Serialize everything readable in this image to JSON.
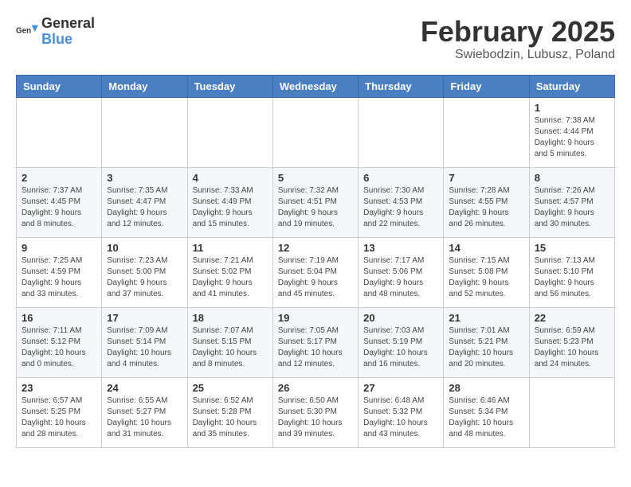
{
  "header": {
    "logo_line1": "General",
    "logo_line2": "Blue",
    "month_year": "February 2025",
    "location": "Swiebodzin, Lubusz, Poland"
  },
  "weekdays": [
    "Sunday",
    "Monday",
    "Tuesday",
    "Wednesday",
    "Thursday",
    "Friday",
    "Saturday"
  ],
  "weeks": [
    [
      {
        "day": "",
        "info": ""
      },
      {
        "day": "",
        "info": ""
      },
      {
        "day": "",
        "info": ""
      },
      {
        "day": "",
        "info": ""
      },
      {
        "day": "",
        "info": ""
      },
      {
        "day": "",
        "info": ""
      },
      {
        "day": "1",
        "info": "Sunrise: 7:38 AM\nSunset: 4:44 PM\nDaylight: 9 hours and 5 minutes."
      }
    ],
    [
      {
        "day": "2",
        "info": "Sunrise: 7:37 AM\nSunset: 4:45 PM\nDaylight: 9 hours and 8 minutes."
      },
      {
        "day": "3",
        "info": "Sunrise: 7:35 AM\nSunset: 4:47 PM\nDaylight: 9 hours and 12 minutes."
      },
      {
        "day": "4",
        "info": "Sunrise: 7:33 AM\nSunset: 4:49 PM\nDaylight: 9 hours and 15 minutes."
      },
      {
        "day": "5",
        "info": "Sunrise: 7:32 AM\nSunset: 4:51 PM\nDaylight: 9 hours and 19 minutes."
      },
      {
        "day": "6",
        "info": "Sunrise: 7:30 AM\nSunset: 4:53 PM\nDaylight: 9 hours and 22 minutes."
      },
      {
        "day": "7",
        "info": "Sunrise: 7:28 AM\nSunset: 4:55 PM\nDaylight: 9 hours and 26 minutes."
      },
      {
        "day": "8",
        "info": "Sunrise: 7:26 AM\nSunset: 4:57 PM\nDaylight: 9 hours and 30 minutes."
      }
    ],
    [
      {
        "day": "9",
        "info": "Sunrise: 7:25 AM\nSunset: 4:59 PM\nDaylight: 9 hours and 33 minutes."
      },
      {
        "day": "10",
        "info": "Sunrise: 7:23 AM\nSunset: 5:00 PM\nDaylight: 9 hours and 37 minutes."
      },
      {
        "day": "11",
        "info": "Sunrise: 7:21 AM\nSunset: 5:02 PM\nDaylight: 9 hours and 41 minutes."
      },
      {
        "day": "12",
        "info": "Sunrise: 7:19 AM\nSunset: 5:04 PM\nDaylight: 9 hours and 45 minutes."
      },
      {
        "day": "13",
        "info": "Sunrise: 7:17 AM\nSunset: 5:06 PM\nDaylight: 9 hours and 48 minutes."
      },
      {
        "day": "14",
        "info": "Sunrise: 7:15 AM\nSunset: 5:08 PM\nDaylight: 9 hours and 52 minutes."
      },
      {
        "day": "15",
        "info": "Sunrise: 7:13 AM\nSunset: 5:10 PM\nDaylight: 9 hours and 56 minutes."
      }
    ],
    [
      {
        "day": "16",
        "info": "Sunrise: 7:11 AM\nSunset: 5:12 PM\nDaylight: 10 hours and 0 minutes."
      },
      {
        "day": "17",
        "info": "Sunrise: 7:09 AM\nSunset: 5:14 PM\nDaylight: 10 hours and 4 minutes."
      },
      {
        "day": "18",
        "info": "Sunrise: 7:07 AM\nSunset: 5:15 PM\nDaylight: 10 hours and 8 minutes."
      },
      {
        "day": "19",
        "info": "Sunrise: 7:05 AM\nSunset: 5:17 PM\nDaylight: 10 hours and 12 minutes."
      },
      {
        "day": "20",
        "info": "Sunrise: 7:03 AM\nSunset: 5:19 PM\nDaylight: 10 hours and 16 minutes."
      },
      {
        "day": "21",
        "info": "Sunrise: 7:01 AM\nSunset: 5:21 PM\nDaylight: 10 hours and 20 minutes."
      },
      {
        "day": "22",
        "info": "Sunrise: 6:59 AM\nSunset: 5:23 PM\nDaylight: 10 hours and 24 minutes."
      }
    ],
    [
      {
        "day": "23",
        "info": "Sunrise: 6:57 AM\nSunset: 5:25 PM\nDaylight: 10 hours and 28 minutes."
      },
      {
        "day": "24",
        "info": "Sunrise: 6:55 AM\nSunset: 5:27 PM\nDaylight: 10 hours and 31 minutes."
      },
      {
        "day": "25",
        "info": "Sunrise: 6:52 AM\nSunset: 5:28 PM\nDaylight: 10 hours and 35 minutes."
      },
      {
        "day": "26",
        "info": "Sunrise: 6:50 AM\nSunset: 5:30 PM\nDaylight: 10 hours and 39 minutes."
      },
      {
        "day": "27",
        "info": "Sunrise: 6:48 AM\nSunset: 5:32 PM\nDaylight: 10 hours and 43 minutes."
      },
      {
        "day": "28",
        "info": "Sunrise: 6:46 AM\nSunset: 5:34 PM\nDaylight: 10 hours and 48 minutes."
      },
      {
        "day": "",
        "info": ""
      }
    ]
  ]
}
